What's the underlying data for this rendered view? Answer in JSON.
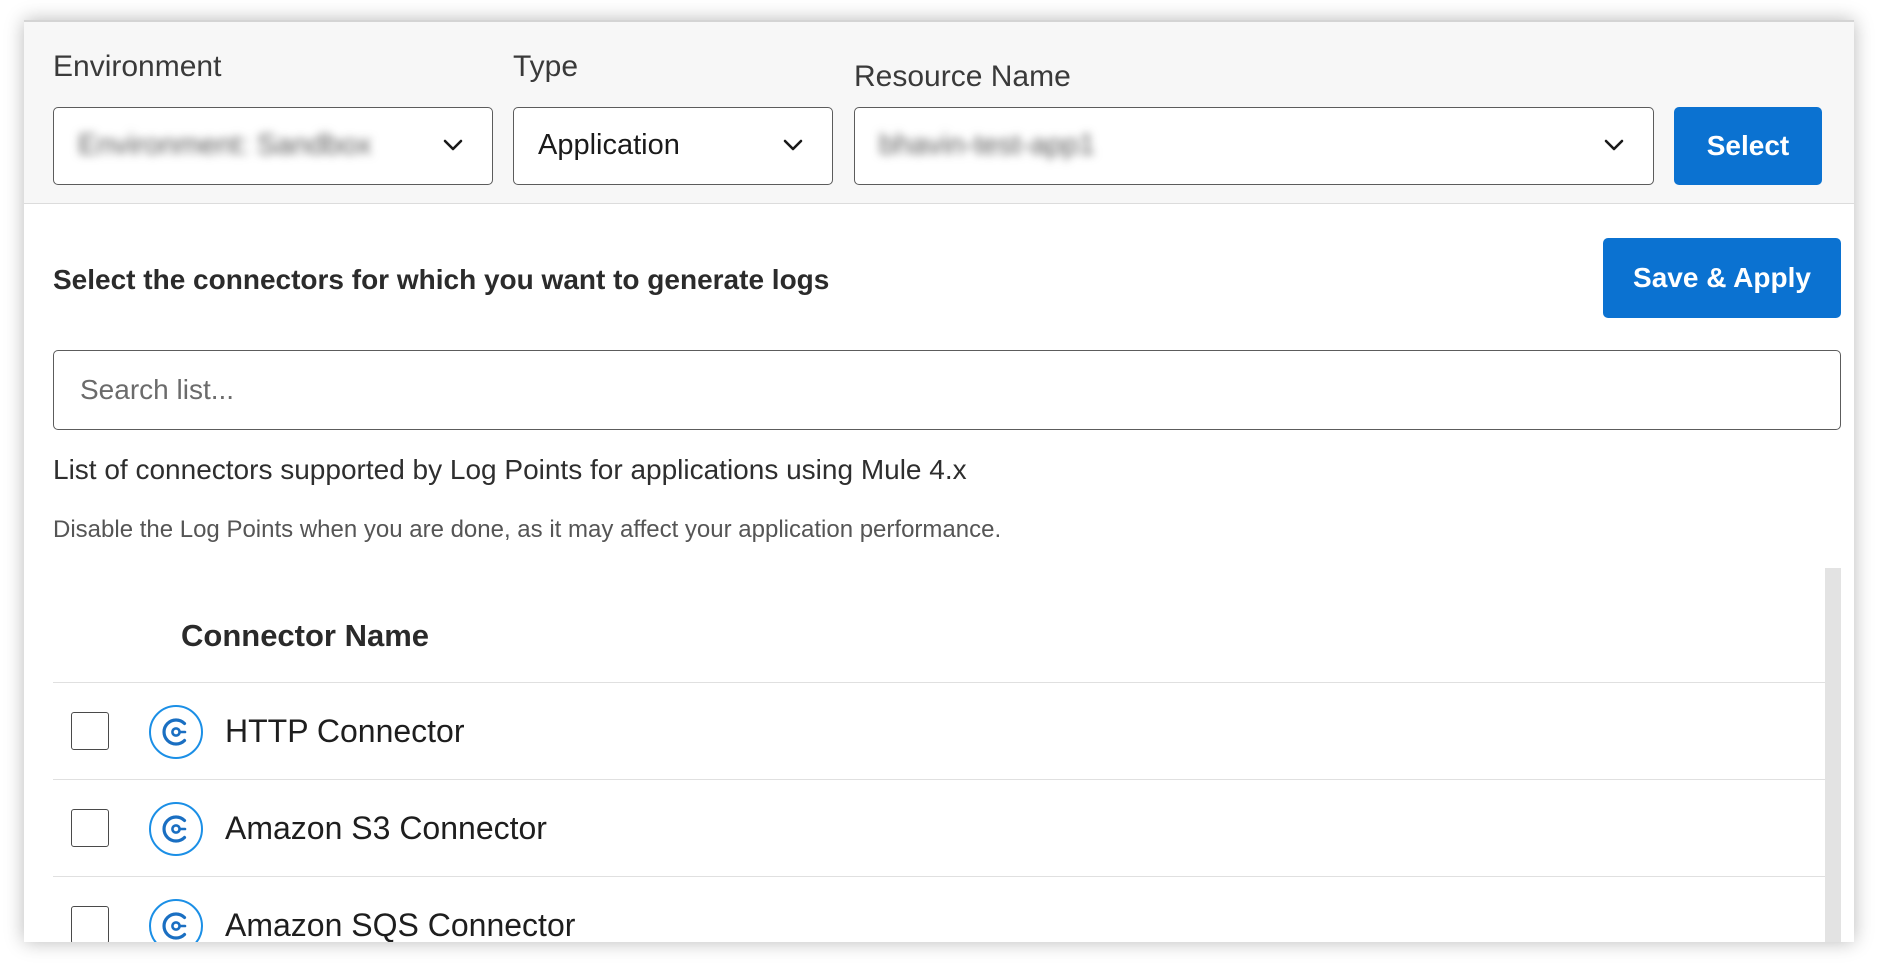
{
  "filters": {
    "environment_label": "Environment",
    "environment_value": "Environment: Sandbox",
    "type_label": "Type",
    "type_value": "Application",
    "resource_label": "Resource Name",
    "resource_value": "bhavin-test-app1",
    "select_label": "Select"
  },
  "main": {
    "heading": "Select the connectors for which you want to generate logs",
    "save_apply_label": "Save & Apply",
    "search_placeholder": "Search list...",
    "info_text": "List of connectors supported by Log Points for applications using Mule 4.x",
    "note_text": "Disable the Log Points when you are done, as it may affect your application performance."
  },
  "table": {
    "column_header": "Connector Name",
    "rows": [
      {
        "label": "HTTP Connector",
        "checked": false,
        "icon": "connector-icon"
      },
      {
        "label": "Amazon S3 Connector",
        "checked": false,
        "icon": "connector-icon"
      },
      {
        "label": "Amazon SQS Connector",
        "checked": false,
        "icon": "connector-icon"
      }
    ]
  },
  "colors": {
    "accent": "#0b72d1",
    "icon_blue": "#1b8fe6"
  }
}
